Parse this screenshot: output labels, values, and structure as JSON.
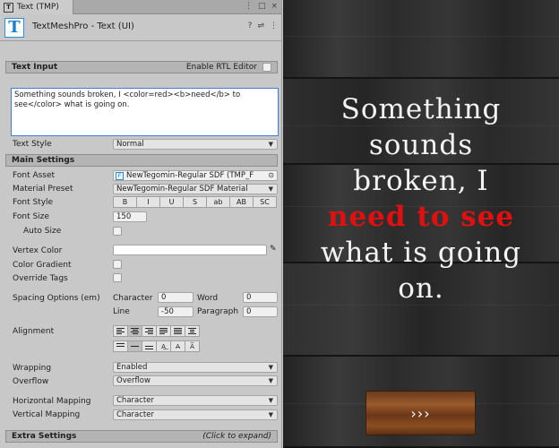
{
  "tab": {
    "title": "Text (TMP)",
    "icon": "T"
  },
  "component": {
    "icon": "T",
    "title": "TextMeshPro - Text (UI)"
  },
  "text_input": {
    "section_label": "Text Input",
    "rtl_label": "Enable RTL Editor",
    "value": "Something sounds broken, I <color=red><b>need</b> to see</color> what is going on.",
    "text_style_label": "Text Style",
    "text_style_value": "Normal"
  },
  "main_settings": {
    "section_label": "Main Settings",
    "font_asset_label": "Font Asset",
    "font_asset_value": "NewTegomin-Regular SDF (TMP_F",
    "material_preset_label": "Material Preset",
    "material_preset_value": "NewTegomin-Regular SDF Material",
    "font_style_label": "Font Style",
    "font_style_buttons": [
      "B",
      "I",
      "U",
      "S",
      "ab",
      "AB",
      "SC"
    ],
    "font_size_label": "Font Size",
    "font_size_value": "150",
    "auto_size_label": "Auto Size",
    "vertex_color_label": "Vertex Color",
    "color_gradient_label": "Color Gradient",
    "override_tags_label": "Override Tags",
    "spacing_label": "Spacing Options (em)",
    "character_label": "Character",
    "character_value": "0",
    "word_label": "Word",
    "word_value": "0",
    "line_label": "Line",
    "line_value": "-50",
    "paragraph_label": "Paragraph",
    "paragraph_value": "0",
    "alignment_label": "Alignment",
    "wrapping_label": "Wrapping",
    "wrapping_value": "Enabled",
    "overflow_label": "Overflow",
    "overflow_value": "Overflow",
    "horizontal_mapping_label": "Horizontal Mapping",
    "horizontal_mapping_value": "Character",
    "vertical_mapping_label": "Vertical Mapping",
    "vertical_mapping_value": "Character"
  },
  "extra_settings": {
    "section_label": "Extra Settings",
    "hint": "(Click to expand)"
  },
  "game_view": {
    "line1": "Something",
    "line2": "sounds",
    "line3": "broken, I",
    "red_part": "need to see",
    "line5": "what is going",
    "line6": "on.",
    "button_label": "›››",
    "text_color": "#f4f4f4",
    "highlight_color": "#e01010"
  }
}
